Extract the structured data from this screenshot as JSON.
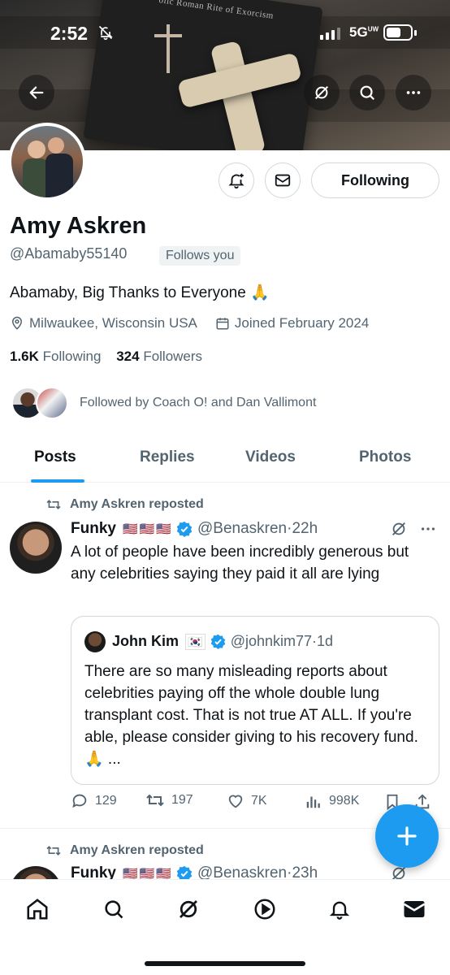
{
  "status_bar": {
    "time": "2:52",
    "network": "5G",
    "network_sub": "UW"
  },
  "banner": {
    "book_title": "olic Roman Rite of Exorcism"
  },
  "profile": {
    "name": "Amy Askren",
    "handle": "@Abamaby55140",
    "follows_you": "Follows you",
    "bio": "Abamaby, Big Thanks to Everyone 🙏",
    "location": "Milwaukee, Wisconsin USA",
    "joined": "Joined February 2024",
    "following_count": "1.6K",
    "following_label": "Following",
    "followers_count": "324",
    "followers_label": "Followers",
    "followed_by": "Followed by Coach O! and Dan Vallimont",
    "following_button": "Following"
  },
  "tabs": [
    {
      "label": "Posts",
      "active": true
    },
    {
      "label": "Replies",
      "active": false
    },
    {
      "label": "Videos",
      "active": false
    },
    {
      "label": "Photos",
      "active": false
    }
  ],
  "posts": [
    {
      "repost_label": "Amy Askren reposted",
      "author": "Funky",
      "flags": "🇺🇸🇺🇸🇺🇸",
      "handle": "@Benaskren",
      "time": "22h",
      "text": "A lot of people have been incredibly generous but any celebrities saying they paid it all are lying",
      "quote": {
        "author": "John Kim",
        "flag": "🇰🇷",
        "handle": "@johnkim77",
        "time": "1d",
        "text": "There are so many misleading reports about celebrities paying off the whole double lung transplant cost. That is not true AT ALL. If you're able, please consider giving to his recovery fund. 🙏 ..."
      },
      "replies": "129",
      "reposts": "197",
      "likes": "7K",
      "views": "998K"
    },
    {
      "repost_label": "Amy Askren reposted",
      "author": "Funky",
      "flags": "🇺🇸🇺🇸🇺🇸",
      "handle": "@Benaskren",
      "time": "23h"
    }
  ],
  "colors": {
    "accent": "#1d9bf0",
    "text": "#0f1419",
    "muted": "#536471",
    "border": "#cfd9de"
  },
  "bottom_nav": [
    "home-icon",
    "search-icon",
    "grok-icon",
    "video-icon",
    "notifications-icon",
    "messages-icon"
  ]
}
